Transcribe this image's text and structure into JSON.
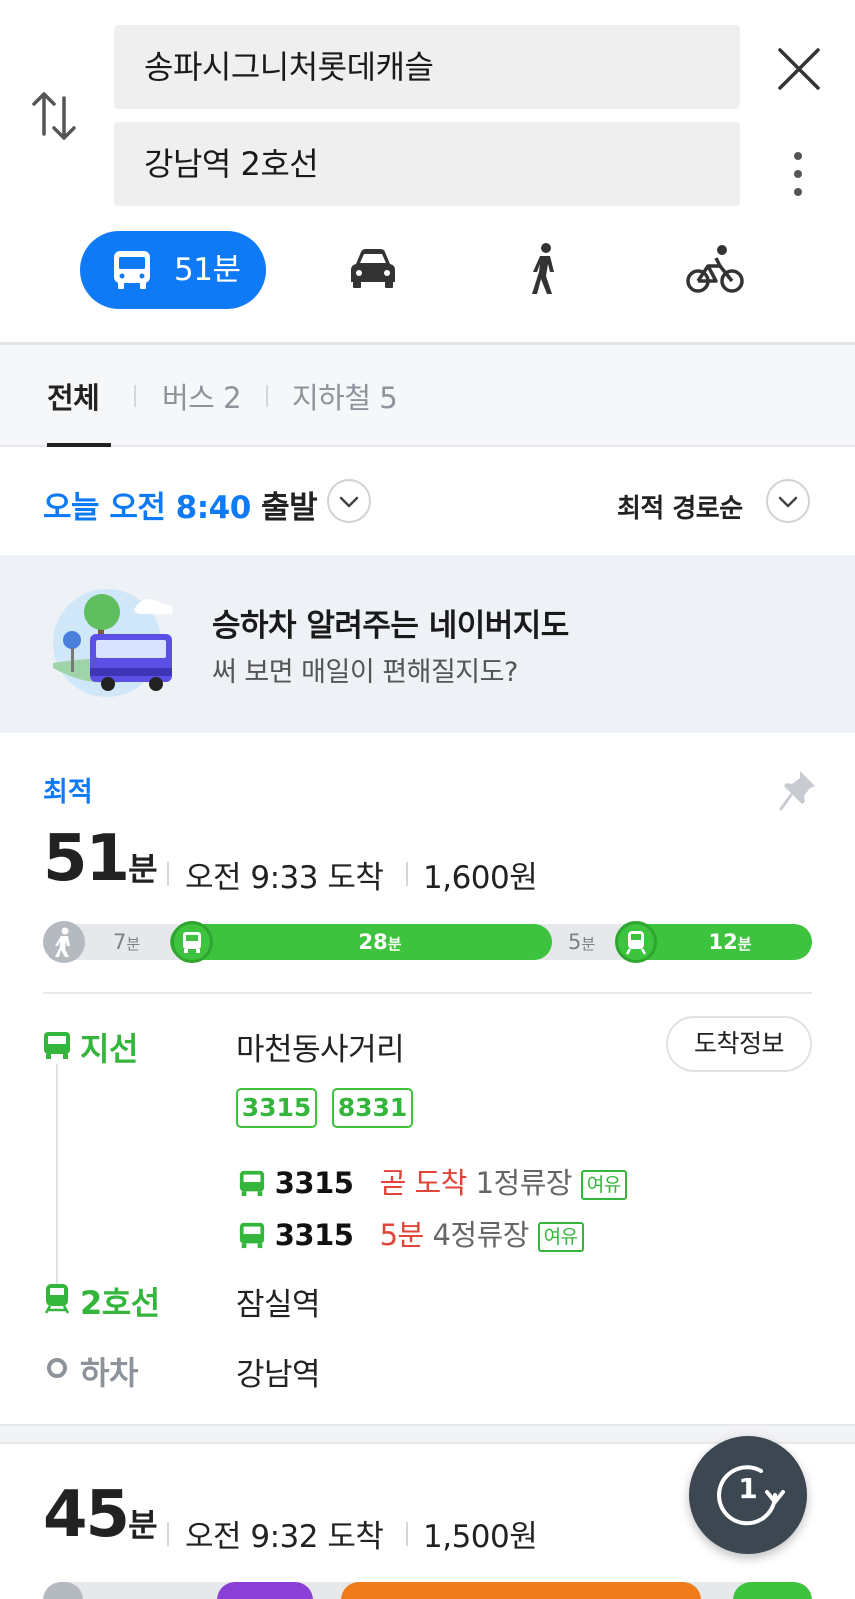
{
  "search": {
    "origin": "송파시그니처롯데캐슬",
    "destination": "강남역 2호선"
  },
  "modes": {
    "transit_time": "51분",
    "items": [
      "bus-icon",
      "car-icon",
      "walk-icon",
      "bike-icon"
    ]
  },
  "tabs": [
    {
      "label": "전체",
      "active": true
    },
    {
      "label": "버스 2",
      "active": false
    },
    {
      "label": "지하철 5",
      "active": false
    }
  ],
  "departure": {
    "day": "오늘",
    "time_label": "오전 8:40",
    "suffix": "출발",
    "sort_label": "최적 경로순"
  },
  "banner": {
    "title": "승하차 알려주는 네이버지도",
    "subtitle": "써 보면 매일이 편해질지도?"
  },
  "route1": {
    "tag": "최적",
    "duration_num": "51",
    "duration_unit": "분",
    "arrival": "오전 9:33 도착",
    "fare": "1,600원",
    "segments": [
      {
        "type": "walk",
        "minutes": "7",
        "unit": "분"
      },
      {
        "type": "bus",
        "minutes": "28",
        "unit": "분"
      },
      {
        "type": "walk",
        "minutes": "5",
        "unit": "분"
      },
      {
        "type": "subway",
        "minutes": "12",
        "unit": "분"
      }
    ],
    "steps": {
      "bus_label": "지선",
      "bus_stop": "마천동사거리",
      "arrival_info_button": "도착정보",
      "bus_numbers": [
        "3315",
        "8331"
      ],
      "arrivals": [
        {
          "bus": "3315",
          "eta": "곧 도착",
          "stops": "1정류장",
          "crowd": "여유"
        },
        {
          "bus": "3315",
          "eta": "5분",
          "stops": "4정류장",
          "crowd": "여유"
        }
      ],
      "subway_label": "2호선",
      "subway_station": "잠실역",
      "alight_label": "하차",
      "alight_station": "강남역"
    }
  },
  "route2": {
    "duration_num": "45",
    "duration_unit": "분",
    "arrival": "오전 9:32 도착",
    "fare": "1,500원"
  },
  "fab": {
    "count": "1"
  },
  "colors": {
    "primary_blue": "#0f7af5",
    "bus_green": "#3ec33e",
    "eta_red": "#e0453a",
    "fab_dark": "#3c4752"
  }
}
